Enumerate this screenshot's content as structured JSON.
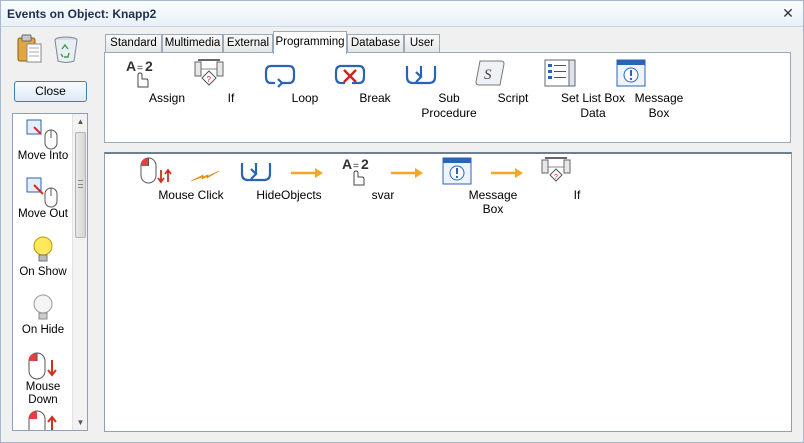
{
  "window": {
    "title": "Events on Object: Knapp2",
    "close_glyph": "✕"
  },
  "left_panel": {
    "paste_icon": "clipboard-icon",
    "delete_icon": "recycle-bin-icon",
    "close_button": "Close",
    "triggers": [
      {
        "label": "Move Into",
        "icon": "move-into-icon"
      },
      {
        "label": "Move Out",
        "icon": "move-out-icon"
      },
      {
        "label": "On Show",
        "icon": "lightbulb-on-icon"
      },
      {
        "label": "On Hide",
        "icon": "lightbulb-off-icon"
      },
      {
        "label": "Mouse Down",
        "icon": "mouse-down-icon"
      },
      {
        "label": "",
        "icon": "mouse-up-icon"
      }
    ]
  },
  "tabs": [
    {
      "label": "Standard",
      "active": false
    },
    {
      "label": "Multimedia",
      "active": false
    },
    {
      "label": "External",
      "active": false
    },
    {
      "label": "Programming",
      "active": true
    },
    {
      "label": "Database",
      "active": false
    },
    {
      "label": "User",
      "active": false
    }
  ],
  "ribbon": [
    {
      "label": "Assign",
      "icon": "assign-icon"
    },
    {
      "label": "If",
      "icon": "if-icon"
    },
    {
      "label": "Loop",
      "icon": "loop-icon"
    },
    {
      "label": "Break",
      "icon": "break-icon"
    },
    {
      "label": "Sub Procedure",
      "icon": "sub-procedure-icon"
    },
    {
      "label": "Script",
      "icon": "script-icon"
    },
    {
      "label": "Set List Box Data",
      "icon": "list-box-icon"
    },
    {
      "label": "Message Box",
      "icon": "message-box-icon"
    }
  ],
  "flow": [
    {
      "label": "Mouse Click",
      "icon": "mouse-click-icon"
    },
    {
      "label": "HideObjects",
      "icon": "sub-procedure-icon"
    },
    {
      "label": "svar",
      "icon": "assign-icon"
    },
    {
      "label": "Message Box",
      "icon": "message-box-icon"
    },
    {
      "label": "If",
      "icon": "if-icon"
    }
  ],
  "colors": {
    "accent": "#3c7fb1",
    "arrow": "#f5a623",
    "icon_blue": "#2a64b4"
  }
}
